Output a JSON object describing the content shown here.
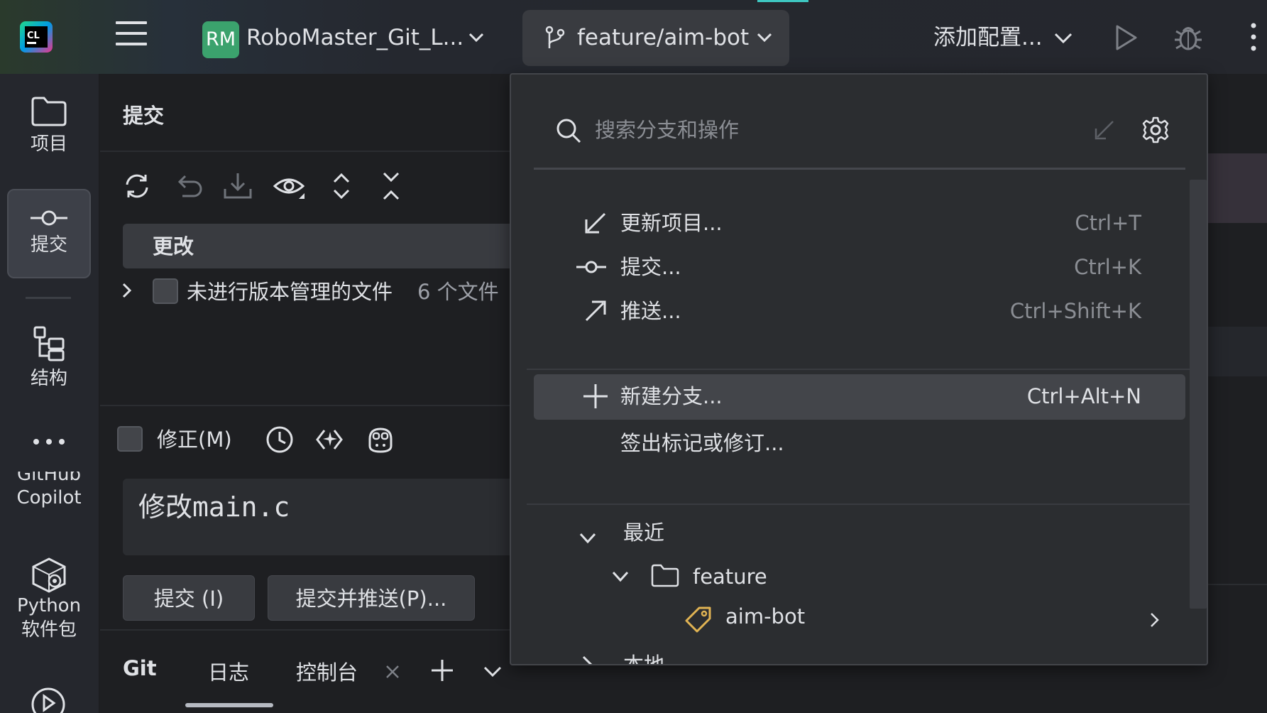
{
  "titlebar": {
    "app_logo_text": "CL",
    "project_badge": "RM",
    "project_name": "RoboMaster_Git_L...",
    "branch": "feature/aim-bot",
    "config_label": "添加配置...",
    "icons": [
      "menu-icon",
      "chevron-down-icon",
      "git-branch-icon",
      "run-icon",
      "debug-icon",
      "more-vertical-icon"
    ]
  },
  "toolstrip": {
    "items": [
      {
        "label": "项目",
        "icon": "folder-icon"
      },
      {
        "label": "提交",
        "icon": "commit-icon"
      },
      {
        "label": "结构",
        "icon": "structure-icon"
      },
      {
        "label": "GitHub\nCopilot",
        "icon": "more-horizontal-icon"
      },
      {
        "label": "Python\n软件包",
        "icon": "python-packages-icon"
      }
    ],
    "copilot_line1": "GitHub",
    "copilot_line2": "Copilot",
    "python_line1": "Python",
    "python_line2": "软件包"
  },
  "commit_panel": {
    "title": "提交",
    "changes_label": "更改",
    "unversioned_label": "未进行版本管理的文件",
    "unversioned_count": "6 个文件",
    "amend_label": "修正(M)",
    "message": "修改main.c",
    "commit_button": "提交 (I)",
    "commit_push_button": "提交并推送(P)..."
  },
  "bottom_tabs": {
    "git": "Git",
    "log": "日志",
    "console": "控制台"
  },
  "branch_popup": {
    "search_placeholder": "搜索分支和操作",
    "actions": [
      {
        "label": "更新项目...",
        "shortcut": "Ctrl+T",
        "icon": "update-icon"
      },
      {
        "label": "提交...",
        "shortcut": "Ctrl+K",
        "icon": "commit-icon"
      },
      {
        "label": "推送...",
        "shortcut": "Ctrl+Shift+K",
        "icon": "push-icon"
      },
      {
        "label": "新建分支...",
        "shortcut": "Ctrl+Alt+N",
        "icon": "plus-icon",
        "highlighted": true
      },
      {
        "label": "签出标记或修订...",
        "shortcut": "",
        "icon": ""
      }
    ],
    "recent_label": "最近",
    "folder_label": "feature",
    "branch_item": "aim-bot",
    "local_label": "本地"
  },
  "colors": {
    "accent": "#3ec7c1",
    "project_badge": "#3ba26d",
    "tag": "#e0b353"
  }
}
